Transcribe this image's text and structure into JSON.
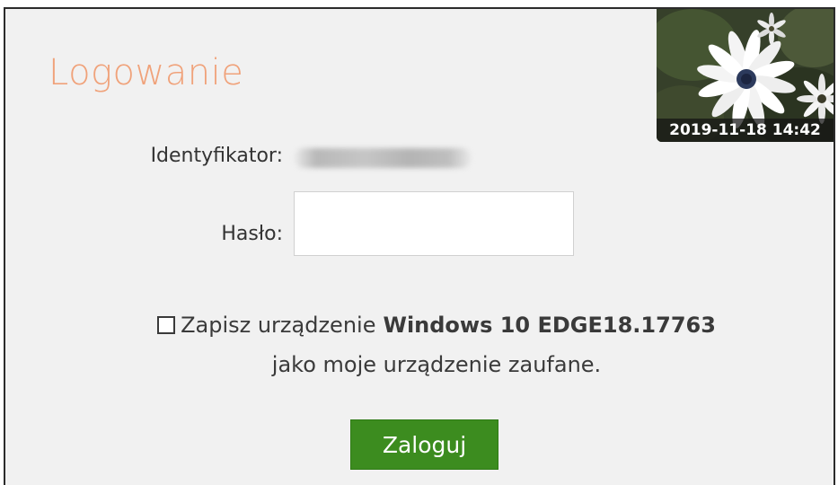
{
  "login": {
    "title": "Logowanie",
    "id_label": "Identyfikator:",
    "password_label": "Hasło:",
    "password_value": "",
    "trust_text_before": "Zapisz urządzenie",
    "device_name": "Windows 10 EDGE18.17763",
    "trust_text_after": "jako moje urządzenie zaufane.",
    "trust_checked": false,
    "submit_label": "Zaloguj"
  },
  "security_image": {
    "timestamp": "2019-11-18 14:42",
    "icon": "daisy-photo"
  },
  "colors": {
    "title": "#f0a27a",
    "button": "#3c8c1f",
    "panel": "#f1f1f1",
    "border": "#2b2b2b"
  }
}
